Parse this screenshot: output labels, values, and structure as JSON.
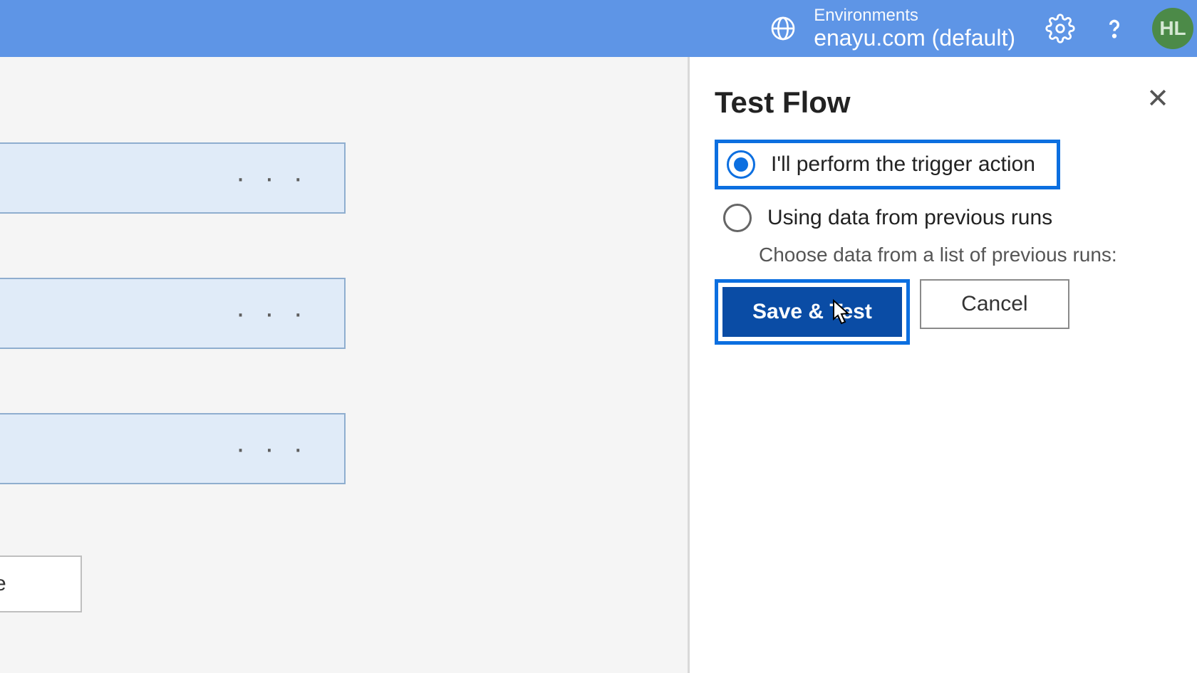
{
  "header": {
    "env_label": "Environments",
    "env_value": "enayu.com (default)",
    "avatar_initials": "HL"
  },
  "panel": {
    "title": "Test Flow",
    "options": {
      "perform": "I'll perform the trigger action",
      "previous": "Using data from previous runs",
      "previous_hint": "Choose data from a list of previous runs:"
    },
    "selected": "perform",
    "buttons": {
      "save_test": "Save & Test",
      "cancel": "Cancel"
    }
  },
  "canvas": {
    "small_card_tail": "e"
  }
}
